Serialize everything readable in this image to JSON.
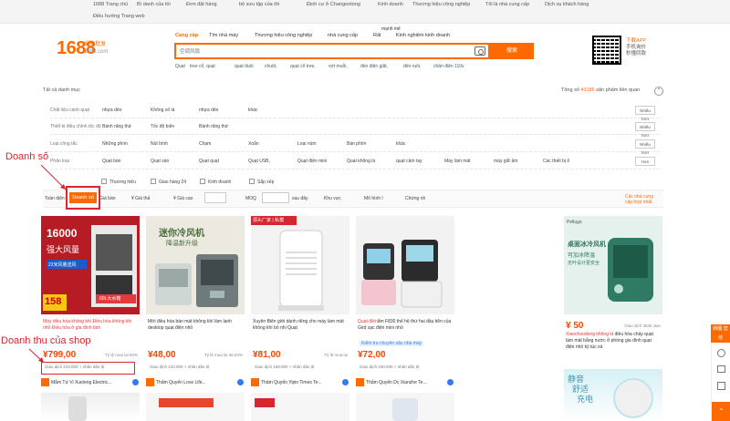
{
  "topbar": {
    "items": [
      "1688 Trang chủ",
      "Bí danh của tôi",
      "Đơn đặt hàng",
      "bộ sưu tập của tôi",
      "Định cư ở Changontong",
      "Kinh doanh",
      "Thương hiệu công nghiệp",
      "Tôi là nhà cung cấp",
      "Dịch vụ khách hàng",
      "Điều hướng Trang web"
    ]
  },
  "logo": {
    "text": "1688",
    "sub1": "采购批发",
    "sub2": "1688.com"
  },
  "search_tabs": [
    "Cung cấp",
    "Tìm nhà máy",
    "Thương hiệu công nghiệp",
    "nhà cung cấp",
    "Rất",
    "mạnh mẽ",
    "Kinh nghiệm kinh doanh"
  ],
  "search": {
    "placeholder": "空调风扇",
    "button": "搜索"
  },
  "hot_words": [
    "Quạt",
    "tree cổ, quạt",
    "quạt đuôi",
    "chuột,",
    "quạt cổ tree,",
    "vợt muỗi,",
    "đèn điện giặt,",
    "đèn ruồi,",
    "chân điện 110v"
  ],
  "app": {
    "line1": "下载APP",
    "line2": "手机询价",
    "line3": "秒懂同款"
  },
  "crumb": "Tất cả danh mục",
  "total": {
    "prefix": "Tổng số",
    "count": "43186",
    "suffix": "sản phẩm liên quan"
  },
  "filters": [
    {
      "label": "Chất liệu cánh quạt",
      "opts": [
        "nhựa dẻo",
        "Không số lá",
        "nhựa dẻo",
        "khác"
      ],
      "more": "Nhiều hơn"
    },
    {
      "label": "Thiết bị điều chỉnh tốc độ",
      "opts": [
        "Bánh răng thứ",
        "Tốc độ biến",
        "Bánh răng thứ"
      ],
      "more": "Nhiều hơn"
    },
    {
      "label": "Loại công tắc",
      "opts": [
        "Những phím",
        "Nút bính",
        "Chạm",
        "Xoắn",
        "Loại núm",
        "Bàn phím",
        "khác"
      ],
      "more": "Nhiều hơn"
    },
    {
      "label": "Phân loại",
      "opts": [
        "Quạt bàn",
        "Quạt sàn",
        "Quạt quạt",
        "Quạt USB,",
        "Quạt điện mini",
        "Quạt không lá",
        "quạt cầm tay",
        "Máy làm mát",
        "máy giữ ấm",
        "Các thiết bị ố"
      ],
      "more": "Hơn"
    }
  ],
  "checks": [
    "Thương hiệu",
    "Giao hàng 24",
    "Kinh doanh",
    "Sắp xếp"
  ],
  "sort": {
    "label_prefix": "Toàn diện",
    "active": "Doanh số",
    "items": [
      "Giá bán",
      "¥ Giá thấ",
      "¥ Giá cao",
      "MOQ",
      "sau đây",
      "Khu vực",
      "Mô hình l",
      "Chứng nh",
      "Các nhà cung cấp hợp nhất"
    ]
  },
  "annotations": {
    "sales": "Doanh số",
    "revenue": "Doanh thu của shop"
  },
  "products": [
    {
      "title_red": "Máy điều hòa không khí Điều hòa không khí nhỏ Điều hòa ở gia đình làm",
      "title": "",
      "price": "¥799,00",
      "meta": "Tỷ lệ mua lại 50%",
      "trade": "Giao dịch 210.000 + nhân dân tệ",
      "shop": "Mẫm Tứ Vi Xueleng Electric...",
      "img_text": [
        "16000",
        "强大风量",
        "22米风量送风",
        "158",
        "60L大水箱"
      ]
    },
    {
      "title_red": "",
      "title": "Mới điều hòa bàn mát không khí làm lạnh desktop quạt điện nhỏ",
      "price": "¥48,00",
      "meta": "Tỷ lệ mua lại 36,84%",
      "trade": "Giao dịch 210.000 + nhân dân tệ",
      "shop": "Thẩm Quyến Love Life...",
      "img_text": [
        "迷你冷风机",
        "降温新升级"
      ]
    },
    {
      "title_red": "",
      "title": "Xuyên Biên giới dành riêng cho máy làm mát không khí bỏ nhi Quạt",
      "price": "¥81,00",
      "meta": "Tỷ lệ mua lại",
      "trade": "Giao dịch 160.000 + nhân dân tệ",
      "shop": "Thâm Quyến Yipin Times Te...",
      "img_text": [
        "源头厂家 | 私模"
      ]
    },
    {
      "title_red": "Quạt điện",
      "title": "ẩm F830 thể hệ thứ hai đầu tiên của Gird sạc điện mini nhỏ",
      "price": "¥72,00",
      "meta": "",
      "trade": "Giao dịch 100.000 + nhân dân tệ",
      "shop": "Thẩm Quyến Dc Xianzhe Te...",
      "badge": "Kiểm tra chuyên sâu nhà máy",
      "img_text": []
    },
    {
      "title_red": "Xiaochaodong không k",
      "title": "í điều hòa chảy quạt làm mát bằng nước ở phòng gia đình quạt điện nhỏ ký túc xá",
      "price": "¥ 50",
      "meta": "Giao dịch 3635 Jian",
      "trade": "",
      "shop": "",
      "img_text": [
        "桌面冰冷风机",
        "可加冰降温",
        "无叶设计更安全"
      ]
    }
  ],
  "side_widgets": {
    "top": "转圈 营结",
    "bottom": ""
  },
  "colors": {
    "brand": "#ff6a00",
    "price": "#ff4400",
    "annotation": "#d8262f"
  }
}
